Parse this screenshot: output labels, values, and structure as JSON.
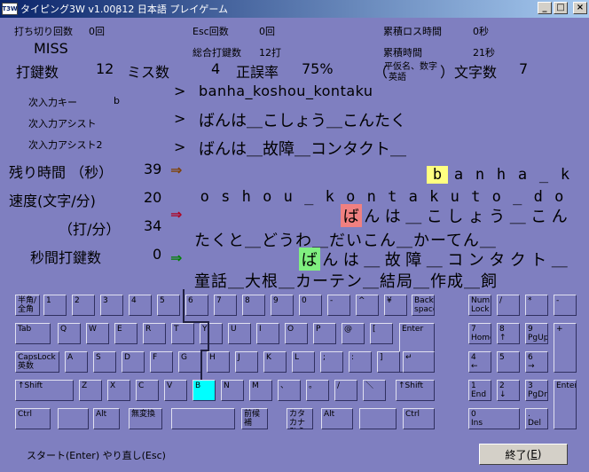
{
  "window": {
    "icon_text": "T3W",
    "title": "タイピング3W  v1.00β12  日本語  プレイゲーム",
    "min_glyph": "_",
    "max_glyph": "□",
    "close_glyph": "×"
  },
  "stats_small": {
    "uchikiri_label": "打ち切り回数",
    "uchikiri_value": "0回",
    "esc_label": "Esc回数",
    "esc_value": "0回",
    "loss_label": "累積ロス時間",
    "loss_value": "0秒",
    "total_keys_label": "総合打鍵数",
    "total_keys_value": "12打",
    "cum_time_label": "累積時間",
    "cum_time_value": "21秒",
    "miss_label": "MISS"
  },
  "stats_main": {
    "keys_label": "打鍵数",
    "keys_value": "12",
    "miss_label": "ミス数",
    "miss_value": "4",
    "accuracy_label": "正誤率",
    "accuracy_value": "75%",
    "charcount_prefix": "（",
    "charcount_note_top": "平仮名、数字",
    "charcount_note_bottom": "英語",
    "charcount_suffix": "）文字数",
    "charcount_value": "7"
  },
  "next": {
    "key_label": "次入力キー",
    "key_value": "b",
    "assist_label": "次入力アシスト",
    "assist2_label": "次入力アシスト2",
    "prompt": ">",
    "line1": "banha_koshou_kontaku",
    "line2": "ばんは＿こしょう＿こんたく",
    "line3": "ばんは＿故障＿コンタクト＿"
  },
  "meters": {
    "remaining_label": "残り時間 （秒）",
    "remaining_value": "39",
    "speed_char_label": "速度(文字/分)",
    "speed_char_value": "20",
    "speed_key_label": "（打/分）",
    "speed_key_value": "34",
    "kps_label": "秒間打鍵数",
    "kps_value": "0",
    "arrow": "⇒"
  },
  "typing": {
    "row1": [
      "b",
      "a",
      "n",
      "h",
      "a",
      "_",
      "k"
    ],
    "row2": [
      "o",
      "s",
      "h",
      "o",
      "u",
      "_",
      "k",
      "o",
      "n",
      "t",
      "a",
      "k",
      "u",
      "t",
      "o",
      "_",
      "d",
      "o"
    ],
    "row3": [
      "ば",
      "ん",
      "は",
      "＿",
      "こ",
      "し",
      "ょ",
      "う",
      "＿",
      "こ",
      "ん"
    ],
    "row4": "たくと＿どうわ＿だいこん＿かーてん＿",
    "row5": [
      "ば",
      "ん",
      "は",
      "＿",
      "故",
      "障",
      "＿",
      "コ",
      "ン",
      "タ",
      "ク",
      "ト",
      "＿"
    ],
    "row6": "童話＿大根＿カーテン＿結局＿作成＿飼"
  },
  "keyboard": {
    "row1": [
      "半角/\n全角",
      "1",
      "2",
      "3",
      "4",
      "5",
      "6",
      "7",
      "8",
      "9",
      "0",
      "-",
      "^",
      "¥",
      "Back\nspace"
    ],
    "row2": [
      "Tab",
      "Q",
      "W",
      "E",
      "R",
      "T",
      "Y",
      "U",
      "I",
      "O",
      "P",
      "@",
      "[",
      "Enter"
    ],
    "row3": [
      "CapsLock\n英数",
      "A",
      "S",
      "D",
      "F",
      "G",
      "H",
      "J",
      "K",
      "L",
      ";",
      ":",
      "]",
      "↵"
    ],
    "row4": [
      "↑Shift",
      "Z",
      "X",
      "C",
      "V",
      "B",
      "N",
      "M",
      "、",
      "。",
      "/",
      "＼",
      "↑Shift"
    ],
    "row5": [
      "Ctrl",
      "",
      "Alt",
      "無変換",
      "",
      "前候補",
      "カタカナ\nひらがな",
      "Alt",
      "",
      "Ctrl"
    ],
    "numpad": [
      "Num\nLock",
      "/",
      "*",
      "-",
      "7\nHome",
      "8\n↑",
      "9\nPgUp",
      "+",
      "4\n←",
      "5",
      "6\n→",
      "1\nEnd",
      "2\n↓",
      "3\nPgDn",
      "Enter",
      "0\nIns",
      ".\nDel"
    ]
  },
  "footer": {
    "status": "スタート(Enter)  やり直し(Esc)",
    "end_label": "終了(",
    "end_key": "E",
    "end_close": ")"
  }
}
